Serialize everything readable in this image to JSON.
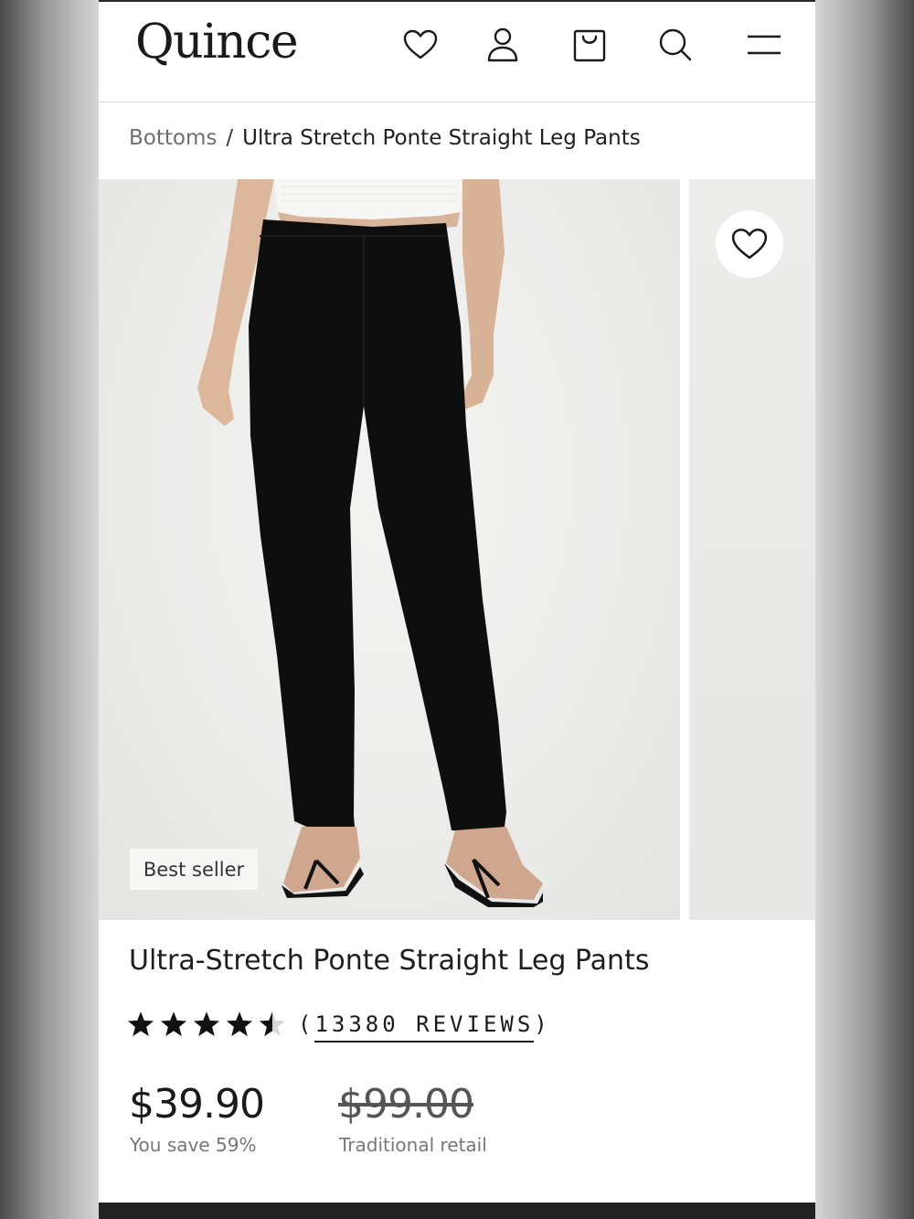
{
  "header": {
    "logo": "Quince",
    "icons": [
      "heart-icon",
      "account-icon",
      "cart-icon",
      "search-icon",
      "menu-icon"
    ]
  },
  "breadcrumb": {
    "parent": "Bottoms",
    "separator": "/",
    "current": "Ultra Stretch Ponte Straight Leg Pants"
  },
  "gallery": {
    "badge": "Best seller"
  },
  "product": {
    "title": "Ultra-Stretch Ponte Straight Leg Pants",
    "rating": 4.5,
    "reviews_prefix": "(",
    "reviews_text": "13380 REVIEWS",
    "reviews_suffix": ")",
    "price": "$39.90",
    "savings": "You save 59%",
    "retail_price": "$99.00",
    "retail_label": "Traditional retail"
  },
  "colors": {
    "text": "#1a1a1a",
    "muted": "#777777",
    "pants": "#0d0d0d",
    "photo_bg": "#ecedeb"
  }
}
